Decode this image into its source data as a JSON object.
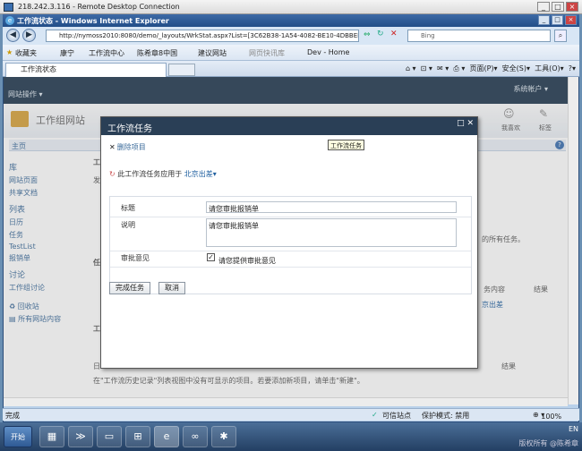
{
  "rdp": {
    "title": "218.242.3.116 - Remote Desktop Connection"
  },
  "ie": {
    "title": "工作流状态 - Windows Internet Explorer",
    "url": "http://nymoss2010:8080/demo/_layouts/WrkStat.aspx?List=[3C62B38-1A54-4082-BE10-4DBBEB73450",
    "search_placeholder": "Bing",
    "fav_label": "收藏夹",
    "fav_items": [
      "康宁",
      "工作流中心",
      "陈希章8中国",
      "建议网站",
      "网页快讯库",
      "Dev - Home"
    ],
    "tab_title": "工作流状态",
    "commands": [
      "页面(P)",
      "安全(S)",
      "工具(O)"
    ]
  },
  "sp": {
    "site_actions": "网站操作",
    "user": "系统帐户",
    "site_title": "工作组网站",
    "home_tab": "主页",
    "right_icons": [
      "我喜欢",
      "标签"
    ],
    "left_nav": {
      "libs_header": "库",
      "libs": [
        "网站页面",
        "共享文档"
      ],
      "lists_header": "列表",
      "lists": [
        "日历",
        "任务",
        "TestList",
        "报销单"
      ],
      "disc_header": "讨论",
      "disc": [
        "工作组讨论"
      ],
      "recycle": "回收站",
      "all_content": "所有网站内容"
    },
    "bg_texts": {
      "t1": "的所有任务。",
      "t2": "务内容",
      "t3": "结果",
      "t4": "京出差",
      "t5": "结果",
      "t6": "在\"工作流历史记录\"列表视图中没有可显示的项目。若要添加新项目，请单击\"新建\"。",
      "h1": "工",
      "h2": "发",
      "h3": "任",
      "h4": "工",
      "h5": "日"
    }
  },
  "dialog": {
    "title": "工作流任务",
    "tooltip": "工作流任务",
    "delete_label": "删除项目",
    "applies_text": "此工作流任务应用于",
    "applies_link": "北京出差",
    "fields": {
      "title_label": "标题",
      "title_value": "请您审批报销单",
      "desc_label": "说明",
      "desc_value": "请您审批报销单",
      "opinion_label": "审批意见",
      "opinion_checkbox_label": "请您提供审批意见",
      "opinion_checked": true
    },
    "complete_button": "完成任务",
    "cancel_button": "取消"
  },
  "status": {
    "text": "完成",
    "zone": "可信站点",
    "protected": "保护模式: 禁用",
    "zoom": "100%"
  },
  "taskbar": {
    "start": "开始",
    "tray_text": "EN",
    "watermark": "陈希章"
  }
}
